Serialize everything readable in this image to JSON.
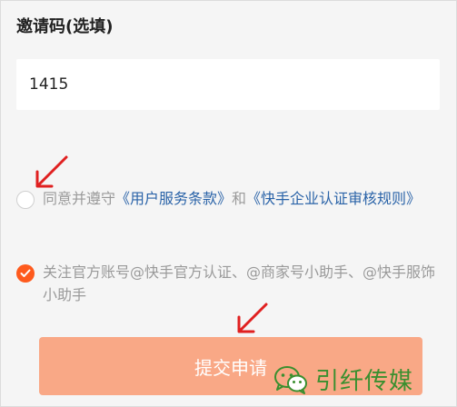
{
  "invite": {
    "title": "邀请码(选填)",
    "value": "1415"
  },
  "agreement": {
    "prefix": "同意并遵守",
    "terms_link": "《用户服务条款》",
    "conjunction": "和",
    "audit_link": "《快手企业认证审核规则》",
    "checked": false
  },
  "follow": {
    "text": "关注官方账号@快手官方认证、@商家号小助手、@快手服饰小助手",
    "checked": true
  },
  "submit": {
    "label": "提交申请"
  },
  "watermark": {
    "text": "引纤传媒"
  },
  "colors": {
    "accent": "#fe5a1d",
    "button_disabled": "#f9a886",
    "link": "#2a63a8",
    "annotation_arrow": "#e02020",
    "watermark": "#3a8f2f"
  }
}
